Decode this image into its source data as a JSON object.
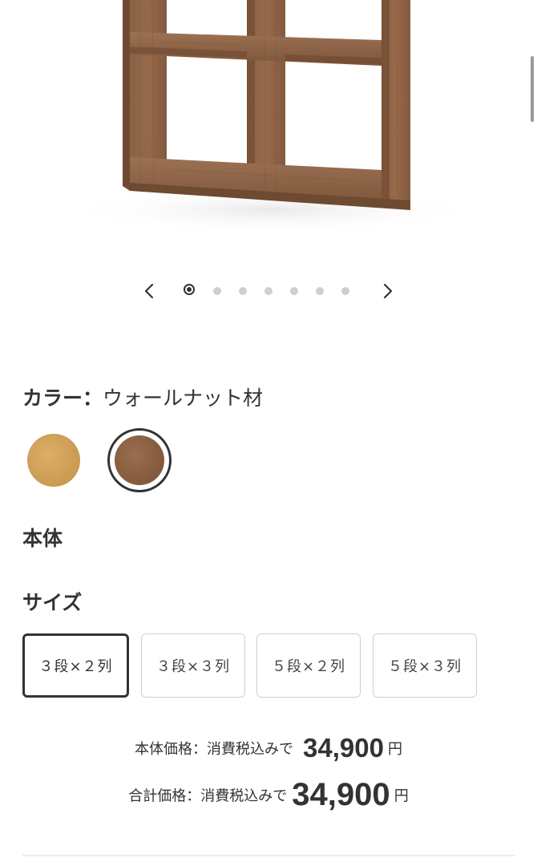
{
  "product": {
    "image_alt": "ウォールナット材 シェルフ",
    "carousel": {
      "total_slides": 7,
      "active_index": 0
    }
  },
  "color": {
    "label": "カラー：",
    "selected_value": "ウォールナット材",
    "swatches": [
      {
        "name": "oak",
        "hex": "#CC9C56",
        "selected": false
      },
      {
        "name": "walnut",
        "hex": "#85593C",
        "selected": true
      }
    ]
  },
  "body_heading": "本体",
  "size": {
    "heading": "サイズ",
    "options": [
      {
        "label": "３段×２列",
        "selected": true
      },
      {
        "label": "３段×３列",
        "selected": false
      },
      {
        "label": "５段×２列",
        "selected": false
      },
      {
        "label": "５段×３列",
        "selected": false
      }
    ]
  },
  "price": {
    "body_label": "本体価格：消費税込みで",
    "body_value": "34,900",
    "total_label": "合計価格：消費税込みで",
    "total_value": "34,900",
    "currency": "円"
  },
  "icons": {
    "prev": "chevron-left-icon",
    "next": "chevron-right-icon"
  },
  "colors": {
    "text": "#333333",
    "wood_walnut": "#85593C",
    "wood_oak": "#CC9C56",
    "border": "#CFCFCF"
  }
}
